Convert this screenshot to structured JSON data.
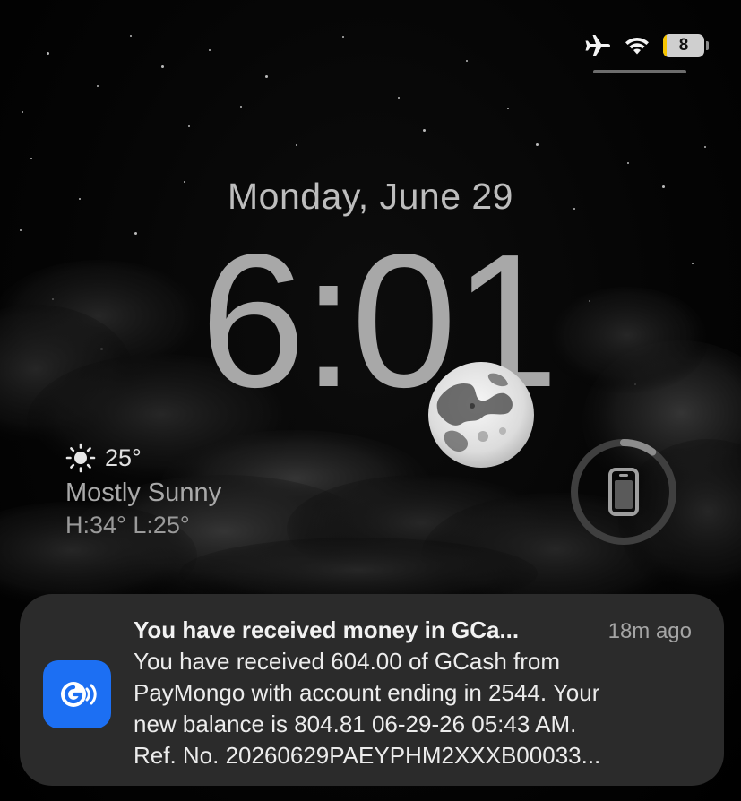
{
  "status_bar": {
    "airplane_icon": "airplane-icon",
    "wifi_icon": "wifi-icon",
    "battery_level": "8",
    "battery_fill_fraction": 0.08,
    "battery_color": "#f5c400"
  },
  "lock_screen": {
    "date": "Monday, June 29",
    "time": "6:01"
  },
  "weather": {
    "icon": "sun-icon",
    "temperature": "25°",
    "condition": "Mostly Sunny",
    "high_low": "H:34° L:25°"
  },
  "phone_widget": {
    "icon": "iphone-icon",
    "ring_fraction": 0.1
  },
  "notification": {
    "app_icon": "gcash-icon",
    "app_color": "#1c6ff3",
    "title": "You have received money in GCa...",
    "time": "18m ago",
    "body_lines": [
      "You have received 604.00 of GCash from",
      "PayMongo with account ending in 2544. Your",
      "new balance is 804.81 06-29-26 05:43 AM.",
      "Ref. No. 20260629PAEYPHM2XXXB00033..."
    ]
  }
}
